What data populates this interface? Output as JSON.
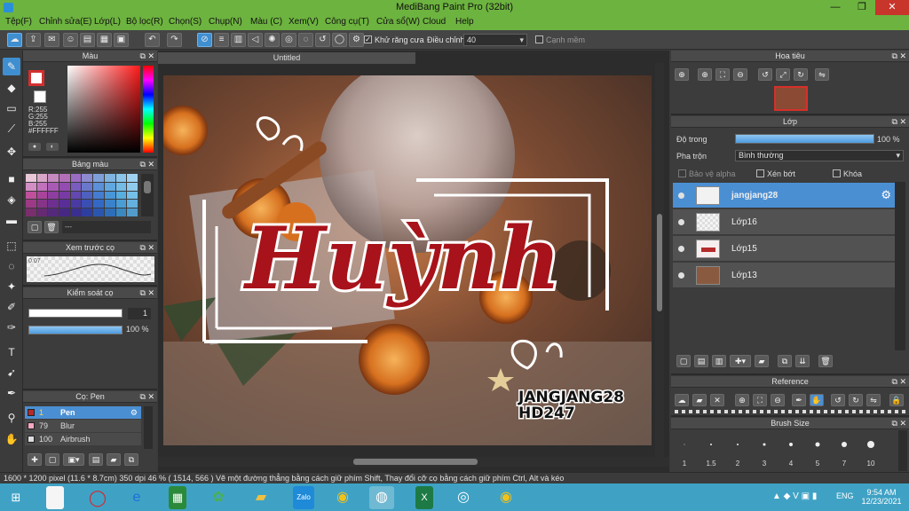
{
  "window": {
    "title": "MediBang Paint Pro (32bit)",
    "min": "—",
    "max": "❐",
    "close": "✕"
  },
  "menu": [
    "Tệp(F)",
    "Chỉnh sửa(E)",
    "Lớp(L)",
    "Bộ lọc(R)",
    "Chọn(S)",
    "Chụp(N)",
    "Màu (C)",
    "Xem(V)",
    "Công cụ(T)",
    "Cửa sổ(W)",
    "Cloud",
    "Help"
  ],
  "toolbar": {
    "antialias_label": "Khử răng cưa",
    "adjust_label": "Điều chỉnh",
    "adjust_value": "40",
    "sharp_label": "Cạnh mềm"
  },
  "color_panel": {
    "title": "Màu",
    "r": "R:255",
    "g": "G:255",
    "b": "B:255",
    "hex": "#FFFFFF"
  },
  "palette_panel": {
    "title": "Bảng màu",
    "empty": "---"
  },
  "brush_preview_panel": {
    "title": "Xem trước cọ",
    "size_label": "0.07"
  },
  "brush_control_panel": {
    "title": "Kiểm soát cọ",
    "size_value": "1",
    "opacity_value": "100 %"
  },
  "brush_panel": {
    "title": "Cọ: Pen",
    "items": [
      {
        "size": "1",
        "name": "Pen",
        "color": "#b52a2a"
      },
      {
        "size": "79",
        "name": "Blur",
        "color": "#f6a7c1"
      },
      {
        "size": "100",
        "name": "Airbrush",
        "color": "#dddddd"
      }
    ]
  },
  "canvas": {
    "tab_title": "Untitled",
    "text_main": "Huỳnh",
    "signature_1": "JANGJANG28",
    "signature_2": "HD247"
  },
  "status": {
    "text": "1600 * 1200 pixel   (11.6 * 8.7cm)   350 dpi   46 %   ( 1514, 566 )   Vẽ một đường thẳng bằng cách giữ phím Shift, Thay đổi cỡ cọ bằng cách giữ phím Ctrl, Alt và kéo"
  },
  "navigator_panel": {
    "title": "Hoa tiêu"
  },
  "layer_panel": {
    "title": "Lớp",
    "opacity_label": "Độ trong",
    "opacity_value": "100 %",
    "opacity": 1.0,
    "blend_label": "Pha trộn",
    "blend_value": "Bình thường",
    "protect_alpha": "Bảo vệ alpha",
    "clipping": "Xén bớt",
    "lock": "Khóa",
    "layers": [
      {
        "name": "jangjang28",
        "selected": true
      },
      {
        "name": "Lớp16",
        "selected": false
      },
      {
        "name": "Lớp15",
        "selected": false
      },
      {
        "name": "Lớp13",
        "selected": false
      }
    ]
  },
  "reference_panel": {
    "title": "Reference"
  },
  "brush_size_panel": {
    "title": "Brush Size",
    "sizes": [
      "1",
      "1.5",
      "2",
      "3",
      "4",
      "5",
      "7",
      "10"
    ]
  },
  "taskbar": {
    "time": "9:54 AM",
    "date": "12/23/2021",
    "lang": "ENG"
  }
}
